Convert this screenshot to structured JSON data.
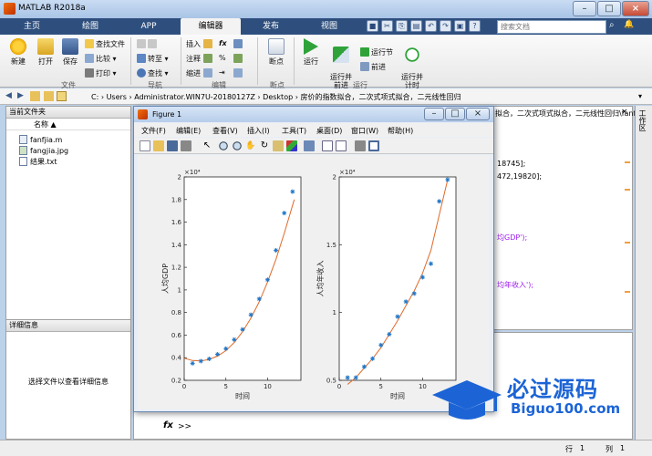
{
  "window": {
    "title": "MATLAB R2018a"
  },
  "tabs": [
    "主页",
    "绘图",
    "APP",
    "编辑器",
    "发布",
    "视图"
  ],
  "active_tab": 3,
  "search": {
    "placeholder": "搜索文档"
  },
  "ribbon": {
    "new": "新建",
    "open": "打开",
    "save": "保存",
    "find_files": "查找文件",
    "compare": "比较",
    "print": "打印",
    "goto": "转至",
    "find": "查找",
    "insert": "插入",
    "comment": "注释",
    "indent": "缩进",
    "breakpoint": "断点",
    "run": "运行",
    "run_advance": "运行并\n前进",
    "run_section": "运行节",
    "advance": "前进",
    "run_time": "运行并\n计时",
    "groups": [
      "文件",
      "导航",
      "编辑",
      "断点",
      "运行"
    ]
  },
  "address": {
    "path": "C: › Users › Administrator.WIN7U-20180127Z › Desktop › 房价的指数拟合，二次式项式拟合，二元线性回归"
  },
  "current_folder": {
    "title": "当前文件夹",
    "column": "名称 ▲",
    "files": [
      "fanfjia.m",
      "fangjia.jpg",
      "结果.txt"
    ]
  },
  "details": {
    "title": "详细信息",
    "message": "选择文件以查看详细信息"
  },
  "editor": {
    "tab_title": "拟合，二次式项式拟合，二元线性回归\\fanfjia.m",
    "lines": [
      "18745];",
      "472,19820];",
      "均GDP');",
      "均年收入');"
    ]
  },
  "workspace": {
    "title": "工作区"
  },
  "command": {
    "prompt": ">>"
  },
  "status": {
    "row_label": "行",
    "row": "1",
    "col_label": "列",
    "col": "1"
  },
  "figure": {
    "title": "Figure 1",
    "menu": [
      "文件(F)",
      "编辑(E)",
      "查看(V)",
      "插入(I)",
      "工具(T)",
      "桌面(D)",
      "窗口(W)",
      "帮助(H)"
    ]
  },
  "chart_data": [
    {
      "type": "scatter+line",
      "xlabel": "时间",
      "ylabel": "人均GDP",
      "exponent_label": "×10⁴",
      "xlim": [
        0,
        14
      ],
      "ylim": [
        0.2,
        2.0
      ],
      "xticks": [
        0,
        5,
        10
      ],
      "yticks": [
        0.2,
        0.4,
        0.6,
        0.8,
        1.0,
        1.2,
        1.4,
        1.6,
        1.8,
        2.0
      ],
      "points": {
        "x": [
          1,
          2,
          3,
          4,
          5,
          6,
          7,
          8,
          9,
          10,
          11,
          12,
          13
        ],
        "y": [
          0.35,
          0.37,
          0.39,
          0.43,
          0.48,
          0.56,
          0.65,
          0.78,
          0.92,
          1.09,
          1.35,
          1.68,
          1.87
        ]
      },
      "fit": {
        "x": [
          0,
          1,
          2,
          3,
          4,
          5,
          6,
          7,
          8,
          9,
          10,
          11,
          12,
          13.2
        ],
        "y": [
          0.395,
          0.375,
          0.372,
          0.385,
          0.415,
          0.462,
          0.535,
          0.63,
          0.75,
          0.895,
          1.07,
          1.27,
          1.5,
          1.8
        ]
      },
      "colors": {
        "points": "#1f77c8",
        "fit": "#e06a2a"
      }
    },
    {
      "type": "scatter+line",
      "xlabel": "时间",
      "ylabel": "人均年收入",
      "exponent_label": "×10⁴",
      "xlim": [
        0,
        14
      ],
      "ylim": [
        0.5,
        2.0
      ],
      "xticks": [
        0,
        5,
        10
      ],
      "yticks": [
        0.5,
        1.0,
        1.5,
        2.0
      ],
      "points": {
        "x": [
          1,
          2,
          3,
          4,
          5,
          6,
          7,
          8,
          9,
          10,
          11,
          12,
          13
        ],
        "y": [
          0.52,
          0.52,
          0.6,
          0.66,
          0.76,
          0.84,
          0.97,
          1.08,
          1.14,
          1.26,
          1.36,
          1.82,
          1.98
        ]
      },
      "fit": {
        "x": [
          1,
          2,
          3,
          4,
          5,
          6,
          7,
          8,
          9,
          10,
          11,
          12,
          13
        ],
        "y": [
          0.47,
          0.52,
          0.59,
          0.66,
          0.74,
          0.84,
          0.94,
          1.05,
          1.16,
          1.29,
          1.46,
          1.72,
          1.98
        ]
      },
      "colors": {
        "points": "#1f77c8",
        "fit": "#e06a2a"
      }
    }
  ],
  "watermark": {
    "text_cn": "必过源码",
    "text_en": "Biguo100.com"
  }
}
